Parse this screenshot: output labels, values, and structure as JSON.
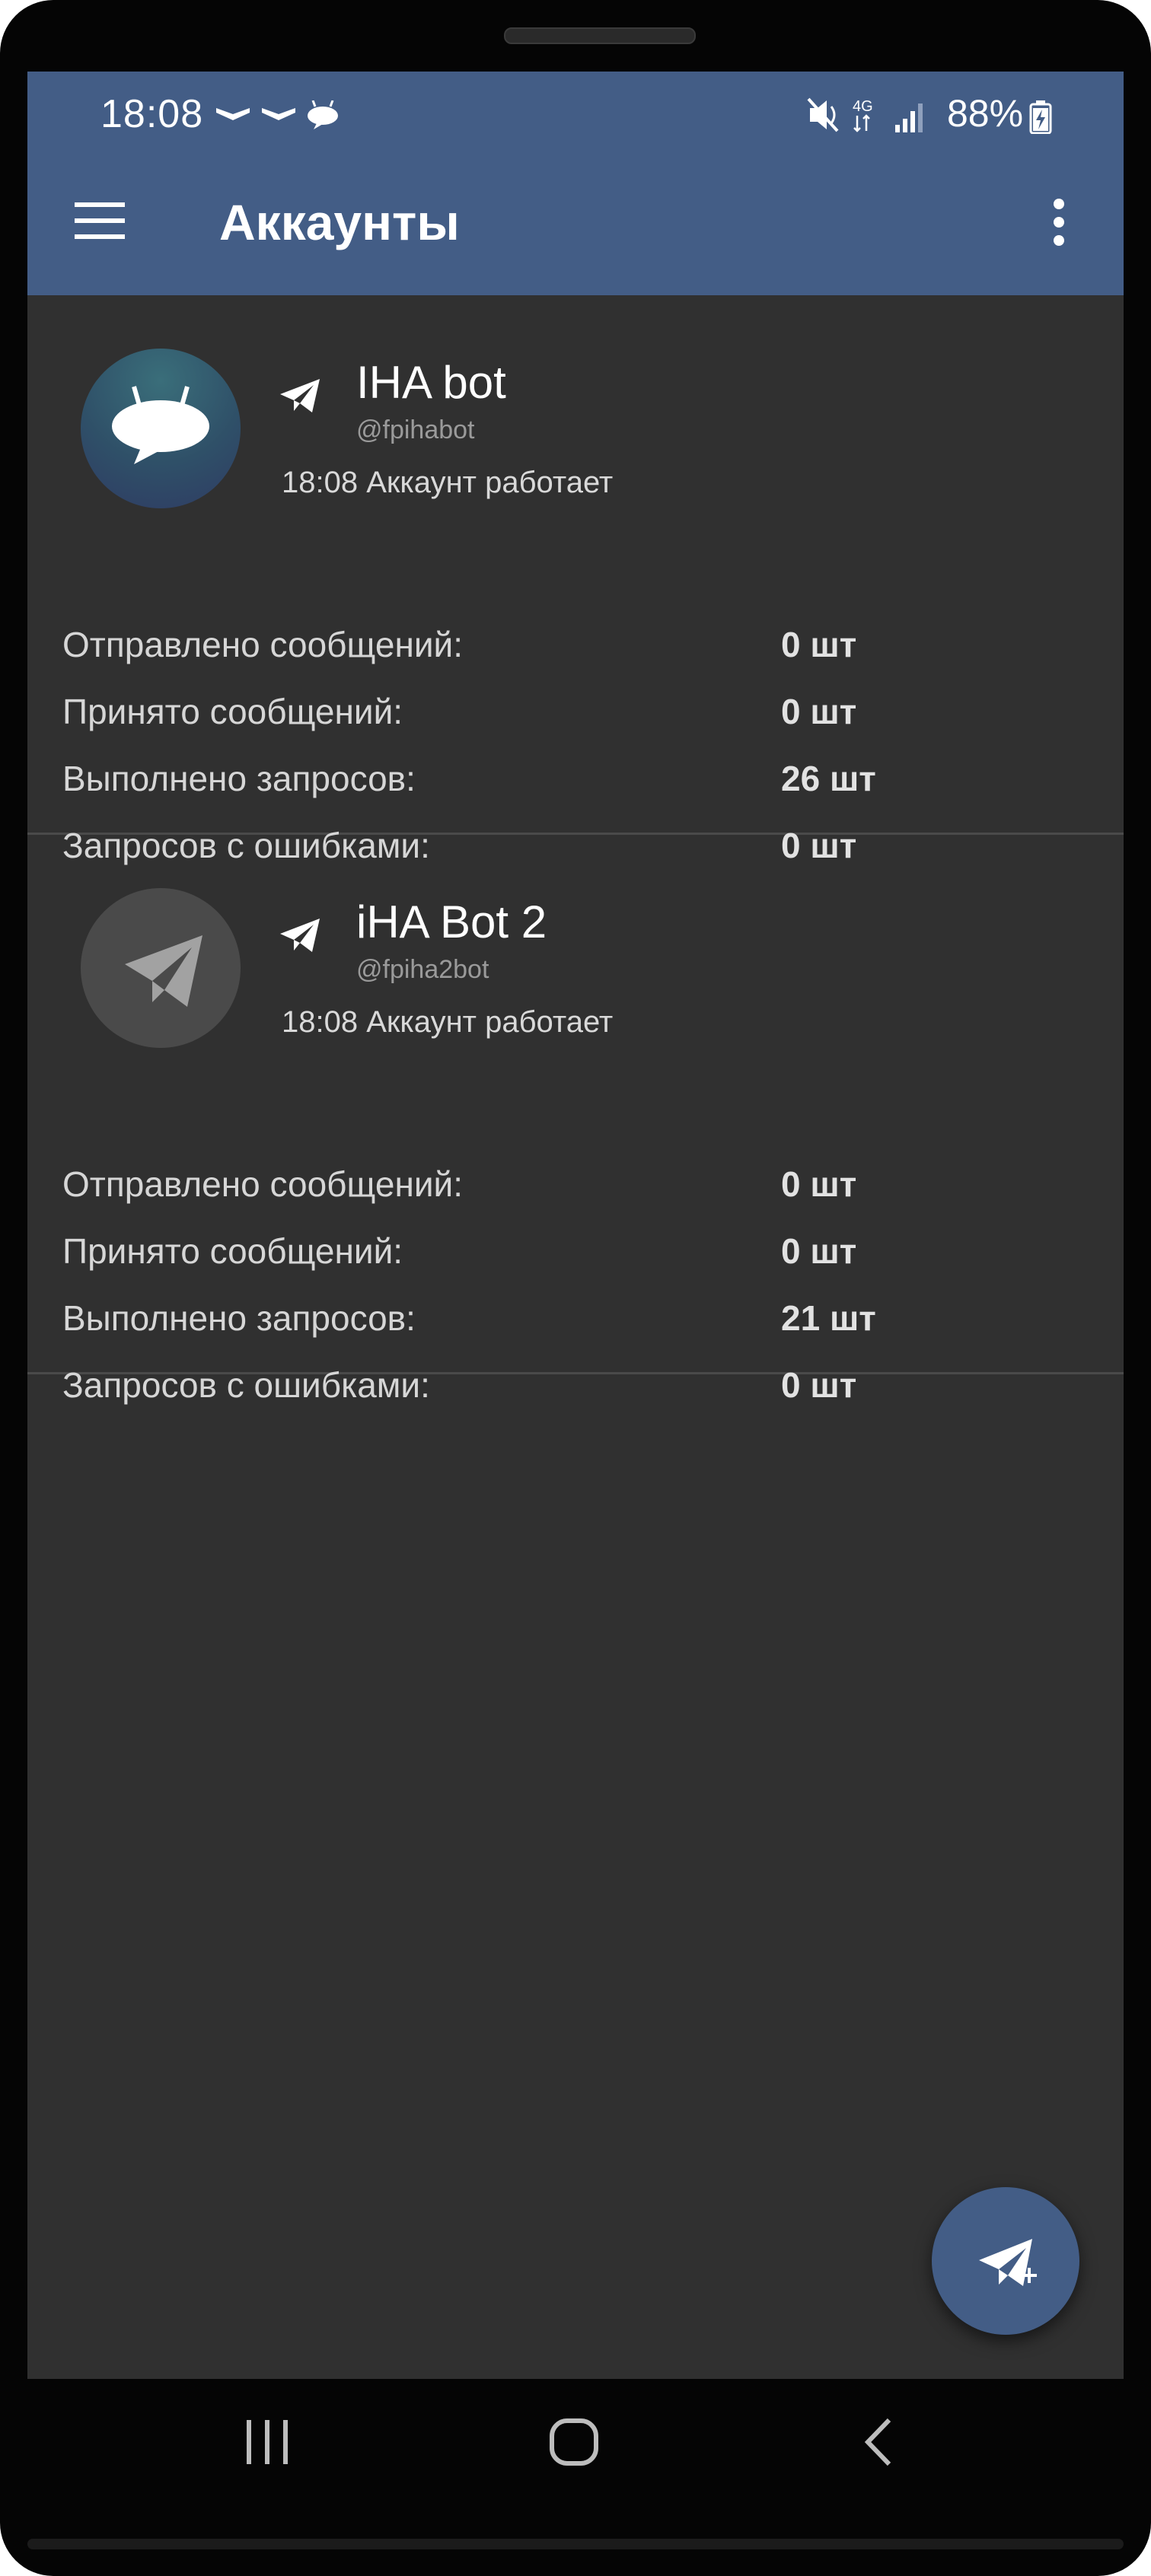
{
  "status_bar": {
    "time": "18:08",
    "network": "4G",
    "battery": "88%",
    "left_icons": [
      "notification-icon",
      "notification-icon",
      "chat-bubble-icon"
    ],
    "right_icons": [
      "mute-icon",
      "network-4g-icon",
      "signal-icon",
      "battery-charging-icon"
    ]
  },
  "app_bar": {
    "title": "Аккаунты",
    "menu_icon": "hamburger-menu-icon",
    "more_icon": "more-vert-icon",
    "color": "#435d86"
  },
  "accounts": [
    {
      "name": "IHA bot",
      "handle": "@fpihabot",
      "status": "18:08 Аккаунт работает",
      "avatar_icon": "speech-bubble-bot-icon",
      "service_icon": "telegram-icon",
      "stats": [
        {
          "label": "Отправлено сообщений:",
          "value": "0 шт"
        },
        {
          "label": "Принято сообщений:",
          "value": "0 шт"
        },
        {
          "label": "Выполнено запросов:",
          "value": "26 шт"
        },
        {
          "label": "Запросов с ошибками:",
          "value": "0 шт"
        }
      ]
    },
    {
      "name": "iHA Bot 2",
      "handle": "@fpiha2bot",
      "status": "18:08 Аккаунт работает",
      "avatar_icon": "telegram-icon",
      "service_icon": "telegram-icon",
      "stats": [
        {
          "label": "Отправлено сообщений:",
          "value": "0 шт"
        },
        {
          "label": "Принято сообщений:",
          "value": "0 шт"
        },
        {
          "label": "Выполнено запросов:",
          "value": "21 шт"
        },
        {
          "label": "Запросов с ошибками:",
          "value": "0 шт"
        }
      ]
    }
  ],
  "fab": {
    "icon": "telegram-add-icon"
  },
  "nav_bar": {
    "recents_icon": "recents-icon",
    "home_icon": "home-icon",
    "back_icon": "back-icon"
  }
}
